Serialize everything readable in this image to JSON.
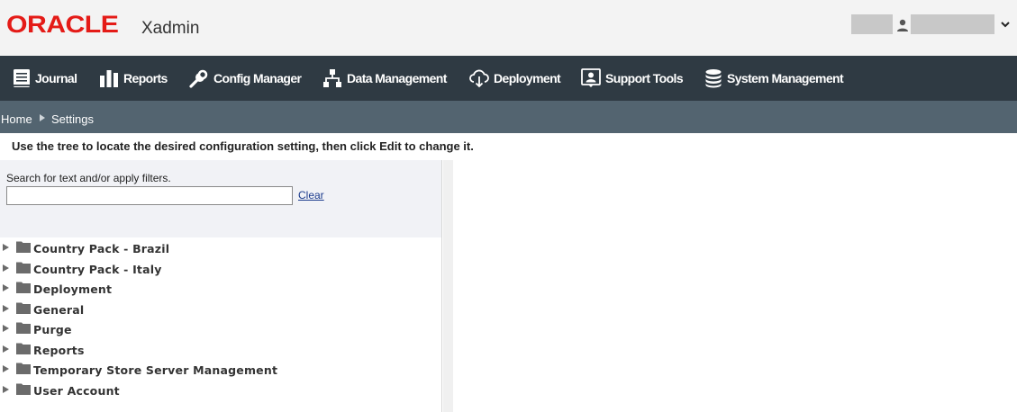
{
  "header": {
    "logo": "ORACLE",
    "app_name": "Xadmin"
  },
  "nav": {
    "items": [
      {
        "label": "Journal",
        "icon": "journal-icon"
      },
      {
        "label": "Reports",
        "icon": "bar-chart-icon"
      },
      {
        "label": "Config Manager",
        "icon": "wrench-icon"
      },
      {
        "label": "Data Management",
        "icon": "hierarchy-icon"
      },
      {
        "label": "Deployment",
        "icon": "cloud-download-icon"
      },
      {
        "label": "Support Tools",
        "icon": "support-person-icon"
      },
      {
        "label": "System Management",
        "icon": "database-icon"
      }
    ]
  },
  "breadcrumb": {
    "home": "Home",
    "current": "Settings"
  },
  "instruction": "Use the tree to locate the desired configuration setting, then click Edit to change it.",
  "search": {
    "label": "Search for text and/or apply filters.",
    "value": "",
    "placeholder": "",
    "clear_label": "Clear"
  },
  "tree": {
    "items": [
      {
        "label": "Country Pack - Brazil"
      },
      {
        "label": "Country Pack - Italy"
      },
      {
        "label": "Deployment"
      },
      {
        "label": "General"
      },
      {
        "label": "Purge"
      },
      {
        "label": "Reports"
      },
      {
        "label": "Temporary Store Server Management"
      },
      {
        "label": "User Account"
      }
    ]
  },
  "colors": {
    "brand_red": "#e41b17",
    "nav_bg": "#2f3a43",
    "breadcrumb_bg": "#536470"
  }
}
